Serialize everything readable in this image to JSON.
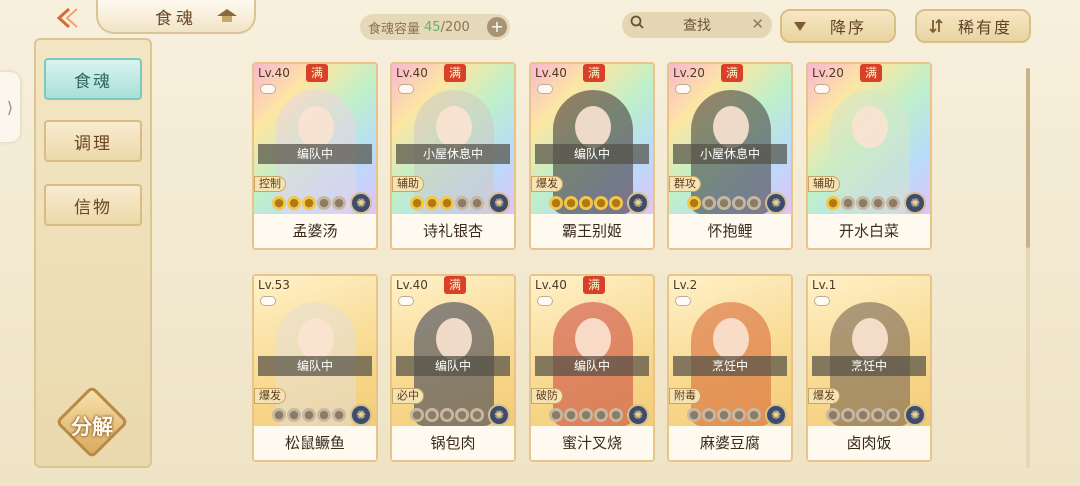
{
  "header": {
    "back_icon": "back-arrow-icon",
    "title": "食魂",
    "roof_icon": "roof-icon",
    "capacity_label": "食魂容量",
    "capacity_current": "45",
    "capacity_max": "/200",
    "capacity_plus": "+",
    "search_text": "查找",
    "search_clear": "✕",
    "sort_order_label": "降序",
    "sort_rarity_label": "稀有度"
  },
  "sidebar": {
    "handle_glyph": "⟩",
    "items": [
      {
        "label": "食魂",
        "active": true
      },
      {
        "label": "调理",
        "active": false
      },
      {
        "label": "信物",
        "active": false
      }
    ],
    "decompose_label": "分解"
  },
  "full_badge": "满",
  "cards": [
    {
      "level": "Lv.40",
      "full": true,
      "status": "编队中",
      "role": "控制",
      "stars_on": 3,
      "stars_total": 5,
      "name": "孟婆汤",
      "frame": "rainbow",
      "tint": "#e9d3e4"
    },
    {
      "level": "Lv.40",
      "full": true,
      "status": "小屋休息中",
      "role": "辅助",
      "stars_on": 3,
      "stars_total": 5,
      "name": "诗礼银杏",
      "frame": "rainbow",
      "tint": "#cfc9c4"
    },
    {
      "level": "Lv.40",
      "full": true,
      "status": "编队中",
      "role": "爆发",
      "stars_on": 5,
      "stars_total": 5,
      "name": "霸王别姬",
      "frame": "rainbow",
      "tint": "#3b2a2e"
    },
    {
      "level": "Lv.20",
      "full": true,
      "status": "小屋休息中",
      "role": "群攻",
      "stars_on": 1,
      "stars_total": 5,
      "name": "怀抱鲤",
      "frame": "rainbow",
      "tint": "#3c3436"
    },
    {
      "level": "Lv.20",
      "full": true,
      "status": "",
      "role": "辅助",
      "stars_on": 1,
      "stars_total": 5,
      "name": "开水白菜",
      "frame": "rainbow",
      "tint": "#d5e6c8"
    },
    {
      "level": "Lv.53",
      "full": false,
      "status": "编队中",
      "role": "爆发",
      "stars_on": 0,
      "stars_total": 5,
      "name": "松鼠鳜鱼",
      "frame": "gold",
      "tint": "#e4dfd5"
    },
    {
      "level": "Lv.40",
      "full": true,
      "status": "编队中",
      "role": "必中",
      "stars_on": 0,
      "stars_total": 5,
      "name": "锅包肉",
      "frame": "gold",
      "tint": "#2e3550"
    },
    {
      "level": "Lv.40",
      "full": true,
      "status": "编队中",
      "role": "破防",
      "stars_on": 0,
      "stars_total": 5,
      "name": "蜜汁叉烧",
      "frame": "gold",
      "tint": "#c8413a"
    },
    {
      "level": "Lv.2",
      "full": false,
      "status": "烹饪中",
      "role": "附毒",
      "stars_on": 0,
      "stars_total": 5,
      "name": "麻婆豆腐",
      "frame": "gold",
      "tint": "#d5612f"
    },
    {
      "level": "Lv.1",
      "full": false,
      "status": "烹饪中",
      "role": "爆发",
      "stars_on": 0,
      "stars_total": 5,
      "name": "卤肉饭",
      "frame": "gold",
      "tint": "#6b5a4a"
    }
  ]
}
